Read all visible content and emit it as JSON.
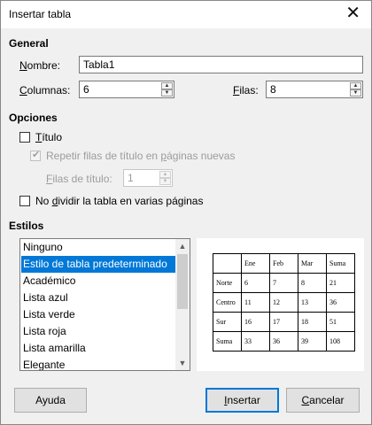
{
  "window": {
    "title": "Insertar tabla",
    "close_glyph": "✕"
  },
  "general": {
    "heading": "General",
    "name_label_u": "N",
    "name_label_rest": "ombre:",
    "name_value": "Tabla1",
    "columns_label_u": "C",
    "columns_label_rest": "olumnas:",
    "columns_value": "6",
    "rows_label_u": "F",
    "rows_label_rest": "ilas:",
    "rows_value": "8"
  },
  "options": {
    "heading": "Opciones",
    "title_cb_u": "T",
    "title_cb_rest": "ítulo",
    "title_checked": false,
    "repeat_pre": "Repetir filas de título en ",
    "repeat_u": "p",
    "repeat_post": "áginas nuevas",
    "repeat_checked": true,
    "repeat_enabled": false,
    "title_rows_u": "F",
    "title_rows_rest": "ilas de título:",
    "title_rows_value": "1",
    "nosplit_pre": "No ",
    "nosplit_u": "d",
    "nosplit_post": "ividir la tabla en varias páginas",
    "nosplit_checked": false
  },
  "styles": {
    "heading": "Estilos",
    "items": [
      "Ninguno",
      "Estilo de tabla predeterminado",
      "Académico",
      "Lista azul",
      "Lista verde",
      "Lista roja",
      "Lista amarilla",
      "Elegante"
    ],
    "selected_index": 1
  },
  "preview": {
    "rows": [
      [
        "",
        "Ene",
        "Feb",
        "Mar",
        "Suma"
      ],
      [
        "Norte",
        "6",
        "7",
        "8",
        "21"
      ],
      [
        "Centro",
        "11",
        "12",
        "13",
        "36"
      ],
      [
        "Sur",
        "16",
        "17",
        "18",
        "51"
      ],
      [
        "Suma",
        "33",
        "36",
        "39",
        "108"
      ]
    ]
  },
  "buttons": {
    "help": "Ayuda",
    "insert_u": "I",
    "insert_rest": "nsertar",
    "cancel_u": "C",
    "cancel_rest": "ancelar"
  },
  "scroll_glyphs": {
    "up": "▲",
    "down": "▼",
    "checkmark": "✔"
  },
  "colors": {
    "selection": "#0078d7",
    "default_button_border": "#0078d7",
    "dialog_bg": "#f0f0f0"
  }
}
